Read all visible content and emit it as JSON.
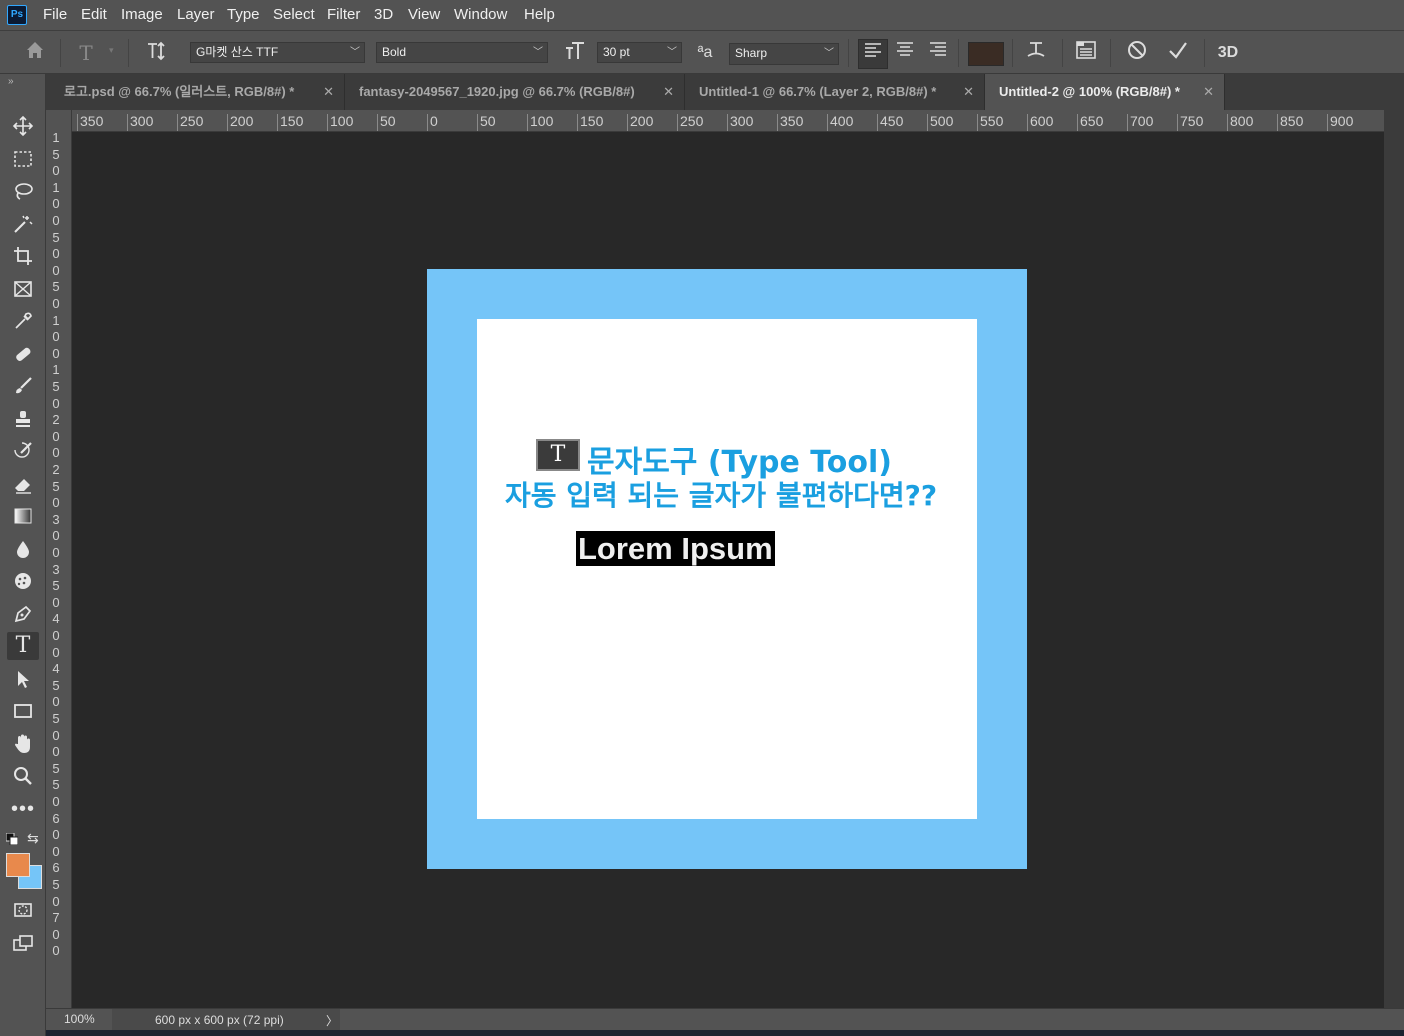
{
  "app": {
    "logo": "Ps"
  },
  "menu": [
    "File",
    "Edit",
    "Image",
    "Layer",
    "Type",
    "Select",
    "Filter",
    "3D",
    "View",
    "Window",
    "Help"
  ],
  "options": {
    "font_family": "G마켓 산스 TTF",
    "font_style": "Bold",
    "font_size": "30 pt",
    "anti_alias": "Sharp",
    "text_color": "#3a2c24"
  },
  "tabs": [
    {
      "label": "로고.psd @ 66.7% (일러스트, RGB/8#) *"
    },
    {
      "label": "fantasy-2049567_1920.jpg @ 66.7% (RGB/8#)"
    },
    {
      "label": "Untitled-1 @ 66.7% (Layer 2, RGB/8#) *"
    },
    {
      "label": "Untitled-2 @ 100% (RGB/8#) *"
    }
  ],
  "active_tab": 3,
  "ruler_top": [
    "350",
    "300",
    "250",
    "200",
    "150",
    "100",
    "50",
    "0",
    "50",
    "100",
    "150",
    "200",
    "250",
    "300",
    "350",
    "400",
    "450",
    "500",
    "550",
    "600",
    "650",
    "700",
    "750",
    "800",
    "850",
    "900"
  ],
  "ruler_left": [
    "1",
    "5",
    "0",
    "1",
    "0",
    "0",
    "5",
    "0",
    "0",
    "5",
    "0",
    "1",
    "0",
    "0",
    "1",
    "5",
    "0",
    "2",
    "0",
    "0",
    "2",
    "5",
    "0",
    "3",
    "0",
    "0",
    "3",
    "5",
    "0",
    "4",
    "0",
    "0",
    "4",
    "5",
    "0",
    "5",
    "0",
    "0",
    "5",
    "5",
    "0",
    "6",
    "0",
    "0",
    "6",
    "5",
    "0",
    "7",
    "0",
    "0"
  ],
  "canvas": {
    "type_icon": "T",
    "headline_line1": "문자도구 (Type Tool)",
    "headline_line2": "자동 입력 되는 글자가 불편하다면??",
    "selected_text": "Lorem Ipsum",
    "border_color": "#75c5f8",
    "accent_color": "#1a9fe0"
  },
  "status": {
    "zoom": "100%",
    "doc_info": "600 px x 600 px (72 ppi)",
    "arrow": "〉"
  },
  "colors": {
    "foreground": "#e8894c",
    "background": "#75c5f8"
  }
}
